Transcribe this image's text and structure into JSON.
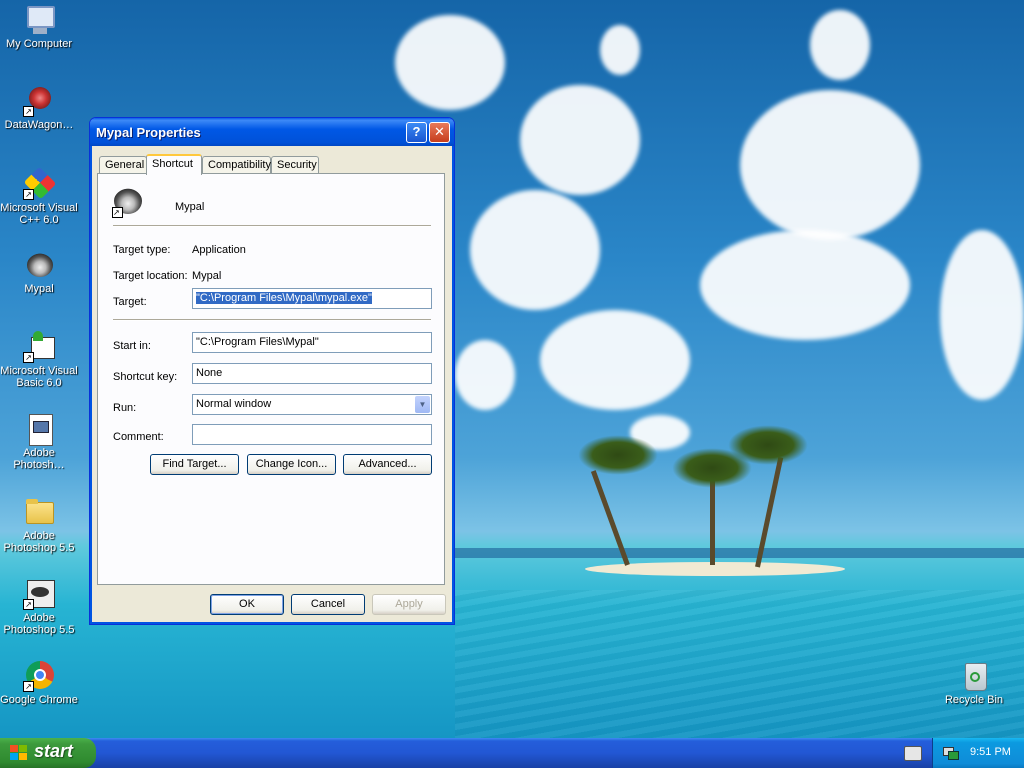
{
  "desktop": {
    "icons": [
      {
        "label": "My Computer"
      },
      {
        "label": "DataWagon…"
      },
      {
        "label": "Microsoft Visual C++ 6.0"
      },
      {
        "label": "Mypal"
      },
      {
        "label": "Microsoft Visual Basic 6.0"
      },
      {
        "label": "Adobe Photosh…"
      },
      {
        "label": "Adobe Photoshop 5.5"
      },
      {
        "label": "Adobe Photoshop 5.5"
      },
      {
        "label": "Google Chrome"
      },
      {
        "label": "Recycle Bin"
      }
    ]
  },
  "window": {
    "title": "Mypal Properties",
    "help_glyph": "?",
    "close_glyph": "✕",
    "tabs": [
      {
        "label": "General"
      },
      {
        "label": "Shortcut"
      },
      {
        "label": "Compatibility"
      },
      {
        "label": "Security"
      }
    ],
    "shortcut": {
      "name": "Mypal",
      "target_type_label": "Target type:",
      "target_type_value": "Application",
      "target_location_label": "Target location:",
      "target_location_value": "Mypal",
      "target_label": "Target:",
      "target_value": "\"C:\\Program Files\\Mypal\\mypal.exe\"",
      "start_in_label": "Start in:",
      "start_in_value": "\"C:\\Program Files\\Mypal\"",
      "shortcut_key_label": "Shortcut key:",
      "shortcut_key_value": "None",
      "run_label": "Run:",
      "run_value": "Normal window",
      "comment_label": "Comment:",
      "comment_value": "",
      "find_target_button": "Find Target...",
      "change_icon_button": "Change Icon...",
      "advanced_button": "Advanced..."
    },
    "buttons": {
      "ok": "OK",
      "cancel": "Cancel",
      "apply": "Apply"
    }
  },
  "taskbar": {
    "start_label": "start",
    "clock": "9:51 PM"
  }
}
